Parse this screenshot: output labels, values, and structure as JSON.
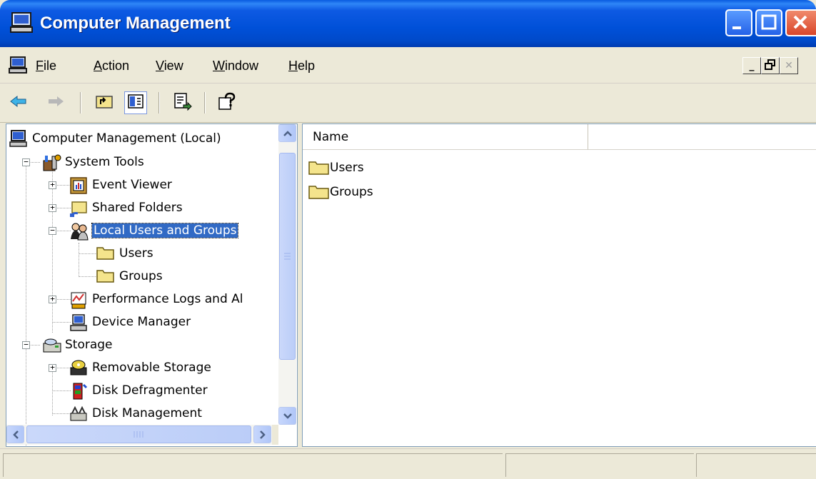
{
  "window": {
    "title": "Computer Management",
    "icon": "computer-management-icon"
  },
  "menu": {
    "items": [
      {
        "label": "File",
        "mnemonic": "F"
      },
      {
        "label": "Action",
        "mnemonic": "A"
      },
      {
        "label": "View",
        "mnemonic": "V"
      },
      {
        "label": "Window",
        "mnemonic": "W"
      },
      {
        "label": "Help",
        "mnemonic": "H"
      }
    ]
  },
  "toolbar": {
    "buttons": [
      "back-arrow-icon",
      "forward-arrow-icon",
      "up-one-level-icon",
      "show-hide-console-tree-icon",
      "export-list-icon",
      "help-icon"
    ]
  },
  "tree": {
    "root": "Computer Management (Local)",
    "system_tools": "System Tools",
    "event_viewer": "Event Viewer",
    "shared_folders": "Shared Folders",
    "local_users_groups": "Local Users and Groups",
    "users": "Users",
    "groups": "Groups",
    "perf_logs": "Performance Logs and Al",
    "device_manager": "Device Manager",
    "storage": "Storage",
    "removable_storage": "Removable Storage",
    "disk_defrag": "Disk Defragmenter",
    "disk_management": "Disk Management"
  },
  "list": {
    "column_header": "Name",
    "items": [
      "Users",
      "Groups"
    ]
  },
  "colors": {
    "titlebar": "#0050D8",
    "selection": "#316AC5",
    "face": "#ECE9D8"
  }
}
